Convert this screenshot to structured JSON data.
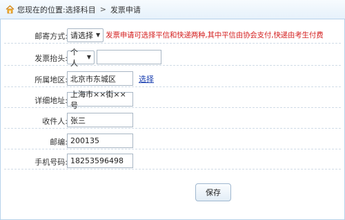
{
  "breadcrumb": {
    "location_label": "您现在的位置:选择科目",
    "separator": ">",
    "current": "发票申请"
  },
  "form": {
    "mail_method": {
      "label": "邮寄方式:",
      "selected": "请选择",
      "hint": "发票申请可选择平信和快递两种,其中平信由协会支付,快递由考生付费"
    },
    "invoice_title": {
      "label": "发票抬头:",
      "selected": "个人",
      "value": ""
    },
    "region": {
      "label": "所属地区:",
      "value": "北京市东城区",
      "link": "选择"
    },
    "address": {
      "label": "详细地址:",
      "value": "上海市××街××号"
    },
    "recipient": {
      "label": "收件人:",
      "value": "张三"
    },
    "postcode": {
      "label": "邮编:",
      "value": "200135"
    },
    "phone": {
      "label": "手机号码:",
      "value": "18253596498"
    }
  },
  "actions": {
    "save_label": "保存"
  },
  "colors": {
    "hint": "#d42020",
    "link": "#1a3fb0",
    "border": "#b7d2ea"
  }
}
